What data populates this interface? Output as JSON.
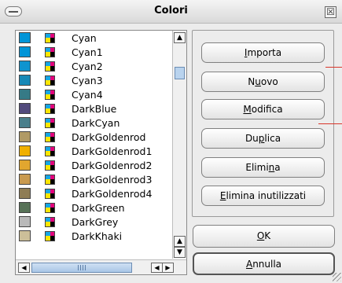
{
  "window": {
    "title": "Colori",
    "minimize_icon": "minimize-icon",
    "close_glyph": "☒"
  },
  "colors": [
    {
      "name": "Cyan",
      "hex": "#0095d8"
    },
    {
      "name": "Cyan1",
      "hex": "#0095d8"
    },
    {
      "name": "Cyan2",
      "hex": "#0f94cf"
    },
    {
      "name": "Cyan3",
      "hex": "#1789b7"
    },
    {
      "name": "Cyan4",
      "hex": "#367a86"
    },
    {
      "name": "DarkBlue",
      "hex": "#524a7c"
    },
    {
      "name": "DarkCyan",
      "hex": "#4a7f8b"
    },
    {
      "name": "DarkGoldenrod",
      "hex": "#b09a65"
    },
    {
      "name": "DarkGoldenrod1",
      "hex": "#f0b000"
    },
    {
      "name": "DarkGoldenrod2",
      "hex": "#e1a62f"
    },
    {
      "name": "DarkGoldenrod3",
      "hex": "#c99a4f"
    },
    {
      "name": "DarkGoldenrod4",
      "hex": "#8f7d55"
    },
    {
      "name": "DarkGreen",
      "hex": "#577257"
    },
    {
      "name": "DarkGrey",
      "hex": "#b9b9b9"
    },
    {
      "name": "DarkKhaki",
      "hex": "#ccbf99"
    }
  ],
  "cmyk_icon": {
    "tl": "#16a6e6",
    "tr": "#e3007a",
    "bl": "#ffe600",
    "br": "#000000"
  },
  "scrollbar": {
    "up_arrow": "▲",
    "down_arrow": "▼",
    "left_arrow": "◀",
    "right_arrow": "▶"
  },
  "buttons": {
    "import": {
      "pre": "",
      "u": "I",
      "post": "mporta"
    },
    "new": {
      "pre": "N",
      "u": "u",
      "post": "ovo"
    },
    "edit": {
      "pre": "",
      "u": "M",
      "post": "odifica"
    },
    "duplicate": {
      "pre": "Du",
      "u": "p",
      "post": "lica"
    },
    "delete": {
      "pre": "Elimi",
      "u": "n",
      "post": "a"
    },
    "delete_unused": {
      "pre": "",
      "u": "E",
      "post": "limina inutilizzati"
    },
    "ok": {
      "pre": "",
      "u": "O",
      "post": "K"
    },
    "cancel": {
      "pre": "",
      "u": "A",
      "post": "nnulla"
    }
  },
  "accent": "#d9362b"
}
